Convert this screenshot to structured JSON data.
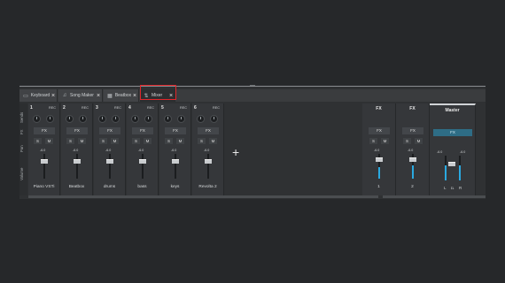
{
  "tabs": [
    {
      "label": "Keyboard",
      "icon": "keyboard-icon",
      "glyph": "▭"
    },
    {
      "label": "Song Maker",
      "icon": "music-note-icon",
      "glyph": "♫"
    },
    {
      "label": "Beatbox",
      "icon": "grid-icon",
      "glyph": "▦"
    },
    {
      "label": "Mixer",
      "icon": "mixer-icon",
      "glyph": "⇅"
    }
  ],
  "close_glyph": "×",
  "side_labels": [
    "Sends",
    "FX",
    "Pan",
    "Volume"
  ],
  "common": {
    "rec": "REC",
    "fx": "FX",
    "solo": "S",
    "mute": "M",
    "pan_value": "-6.0"
  },
  "channels": [
    {
      "number": "1",
      "name": "Piano VSTi"
    },
    {
      "number": "2",
      "name": "Beatbox"
    },
    {
      "number": "3",
      "name": "drums"
    },
    {
      "number": "4",
      "name": "bass"
    },
    {
      "number": "5",
      "name": "keys"
    },
    {
      "number": "6",
      "name": "Revolta 2"
    }
  ],
  "add_channel": "+",
  "buses": [
    {
      "title": "FX",
      "name": "1",
      "level": 0.45
    },
    {
      "title": "FX",
      "name": "2",
      "level": 0.55
    }
  ],
  "master": {
    "title": "Master",
    "fx": "FX",
    "left_value": "-6.0",
    "right_value": "-6.0",
    "label_l": "L",
    "label_r": "R",
    "label_mid": "ɪʟ"
  },
  "colors": {
    "accent": "#2aa9e0",
    "highlight": "#e0262a",
    "master_fx": "#2e6d86"
  }
}
